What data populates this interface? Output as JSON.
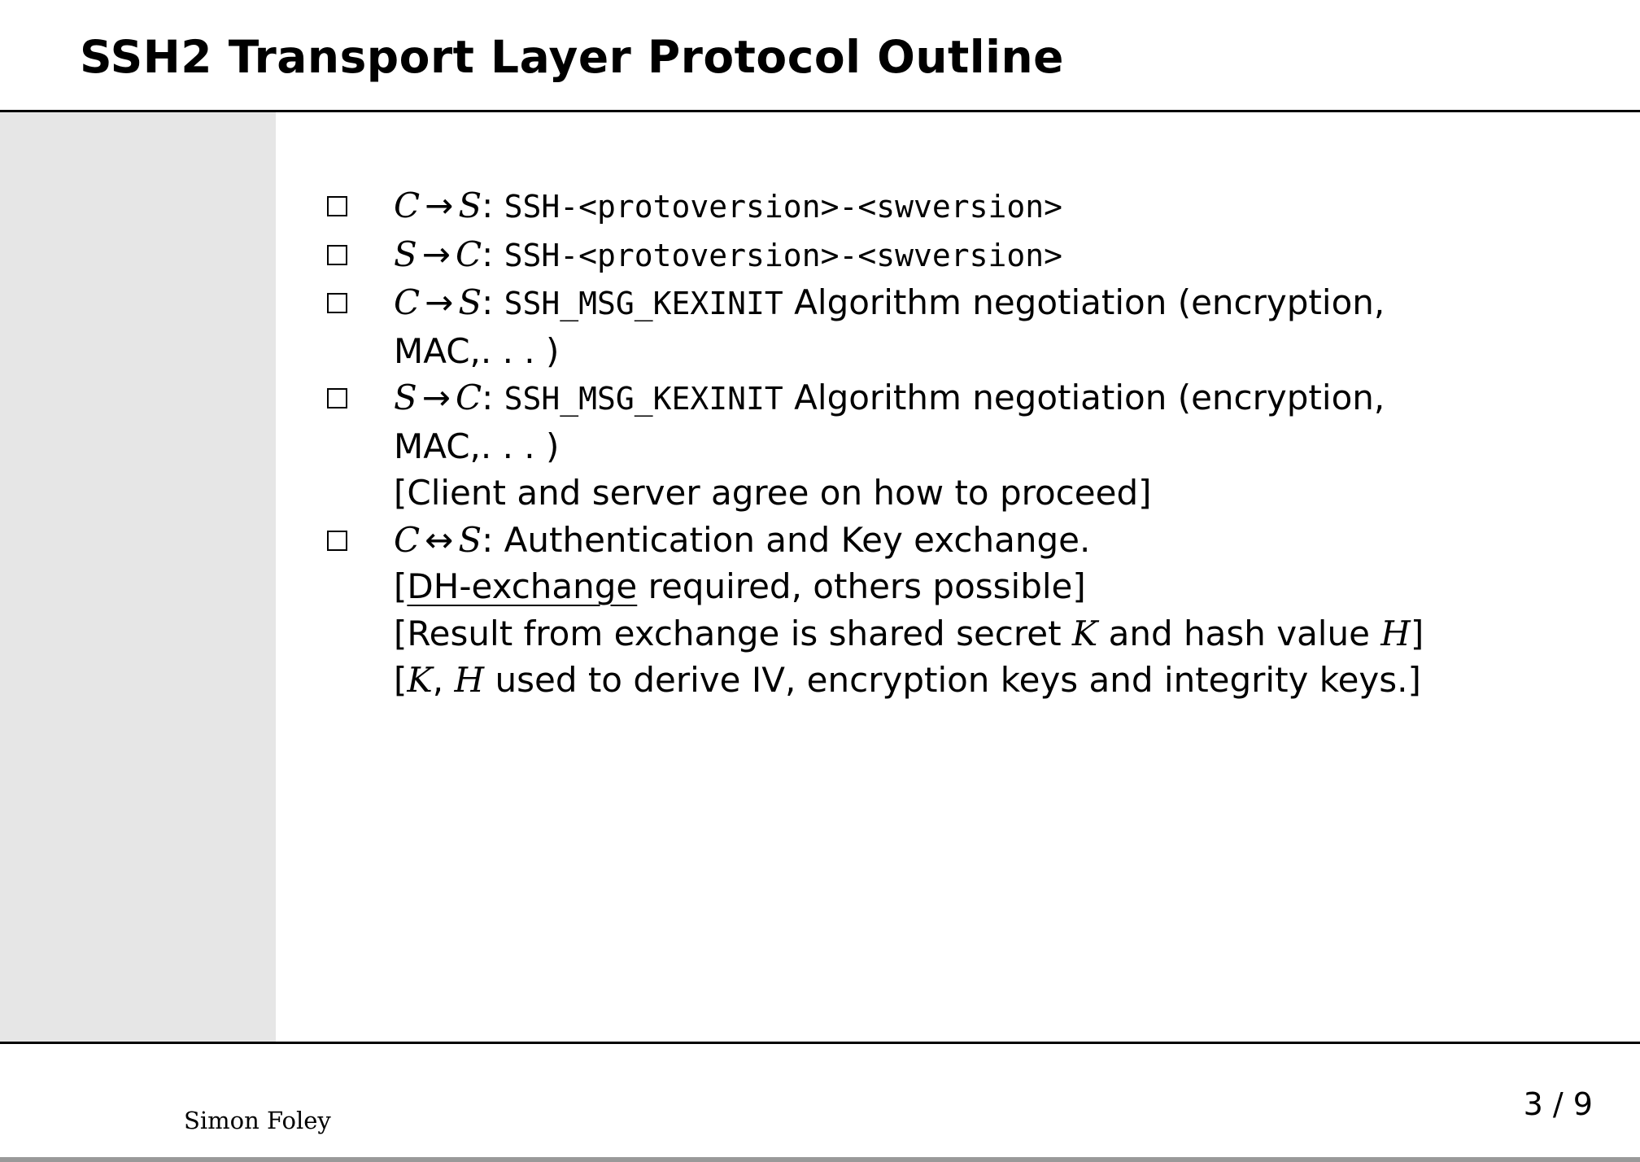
{
  "slide": {
    "title": "SSH2 Transport Layer Protocol Outline",
    "author": "Simon Foley",
    "page": "3 / 9"
  },
  "items": [
    {
      "from": "C",
      "arrow": "→",
      "to": "S",
      "colon": ":",
      "code": "SSH-<protoversion>-<swversion>"
    },
    {
      "from": "S",
      "arrow": "→",
      "to": "C",
      "colon": ":",
      "code": "SSH-<protoversion>-<swversion>"
    },
    {
      "from": "C",
      "arrow": "→",
      "to": "S",
      "colon": ":",
      "code": "SSH_MSG_KEXINIT",
      "text": "Algorithm negotiation (encryption,",
      "cont": "MAC,. . . )"
    },
    {
      "from": "S",
      "arrow": "→",
      "to": "C",
      "colon": ":",
      "code": "SSH_MSG_KEXINIT",
      "text": "Algorithm negotiation (encryption,",
      "cont": "MAC,. . . )",
      "note": "[Client and server agree on how to proceed]"
    },
    {
      "from": "C",
      "arrow": "↔",
      "to": "S",
      "colon": ":",
      "text": "Authentication and Key exchange.",
      "note1_open": "[",
      "note1_link": "DH-exchange",
      "note1_rest": " required, others possible]",
      "note2_a": "[Result from exchange is shared secret ",
      "note2_k": "K",
      "note2_b": " and hash value ",
      "note2_h": "H",
      "note2_c": "]",
      "note3_open": "[",
      "note3_k": "K",
      "note3_comma": ", ",
      "note3_h": "H",
      "note3_rest": " used to derive IV, encryption keys and integrity keys.]"
    }
  ]
}
